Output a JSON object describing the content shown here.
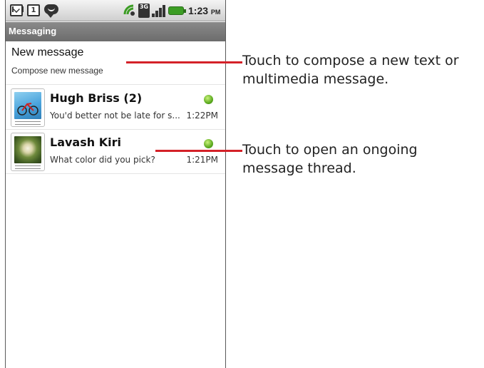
{
  "status_bar": {
    "icons": [
      "gmail-icon",
      "calendar-icon",
      "chat-icon",
      "signal-wave-icon",
      "3g-icon",
      "signal-bars-icon",
      "battery-icon"
    ],
    "calendar_day": "1",
    "network": "3G",
    "time": "1:23",
    "ampm": "PM"
  },
  "app": {
    "title": "Messaging"
  },
  "new_message": {
    "label": "New message",
    "sublabel": "Compose new message"
  },
  "threads": [
    {
      "name": "Hugh Briss (2)",
      "snippet": "You'd better not be late for s...",
      "time": "1:22PM",
      "presence": "online"
    },
    {
      "name": "Lavash Kiri",
      "snippet": "What color did you pick?",
      "time": "1:21PM",
      "presence": "online"
    }
  ],
  "annotations": [
    {
      "text": "Touch to compose a new text or multimedia message."
    },
    {
      "text": "Touch to open an ongoing message thread."
    }
  ],
  "colors": {
    "callout": "#d42128",
    "presence": "#55a51a",
    "title_bar": "#777777"
  }
}
